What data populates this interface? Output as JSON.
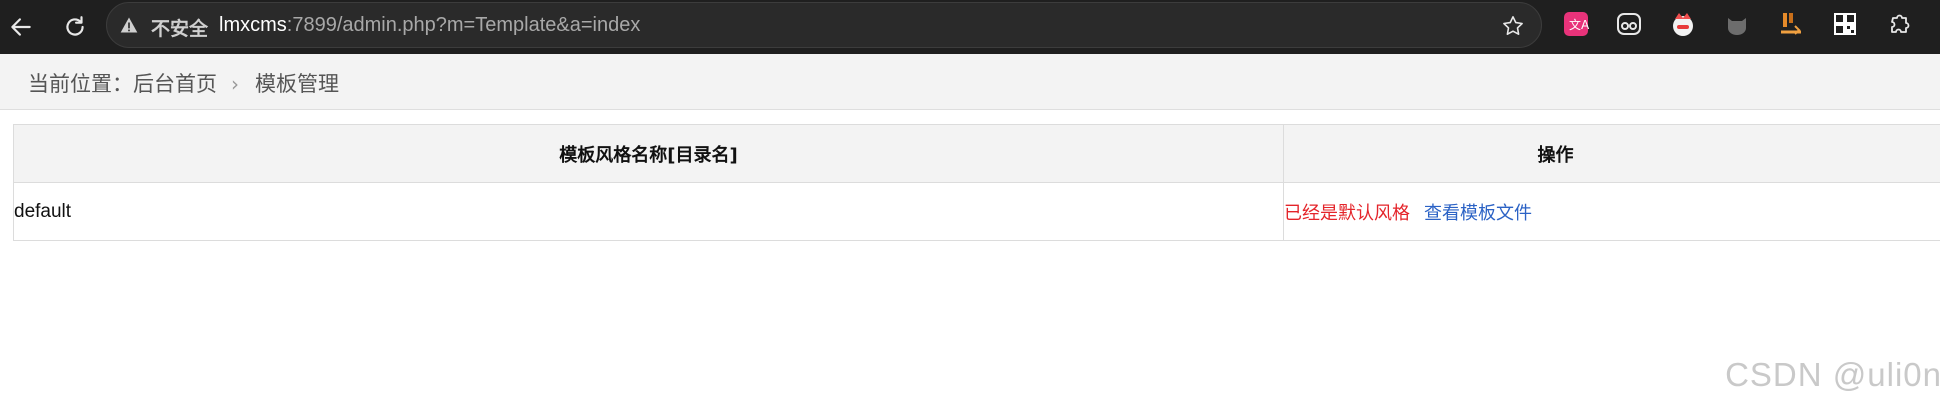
{
  "browser": {
    "security_label": "不安全",
    "url_host": "lmxcms",
    "url_path": ":7899/admin.php?m=Template&a=index",
    "extensions": [
      "translate-icon",
      "glasses-extension-icon",
      "cat-extension-icon",
      "ghost-extension-icon",
      "download-extension-icon",
      "qrcode-icon",
      "puzzle-icon"
    ]
  },
  "breadcrumb": {
    "prefix": "当前位置：",
    "home": "后台首页",
    "current": "模板管理"
  },
  "table": {
    "headers": [
      "模板风格名称[目录名]",
      "操作"
    ],
    "rows": [
      {
        "name": "default",
        "status": "已经是默认风格",
        "action": "查看模板文件"
      }
    ]
  },
  "watermark": "CSDN @uli0n",
  "colors": {
    "status_red": "#e4242a",
    "link_blue": "#2b62c5"
  }
}
